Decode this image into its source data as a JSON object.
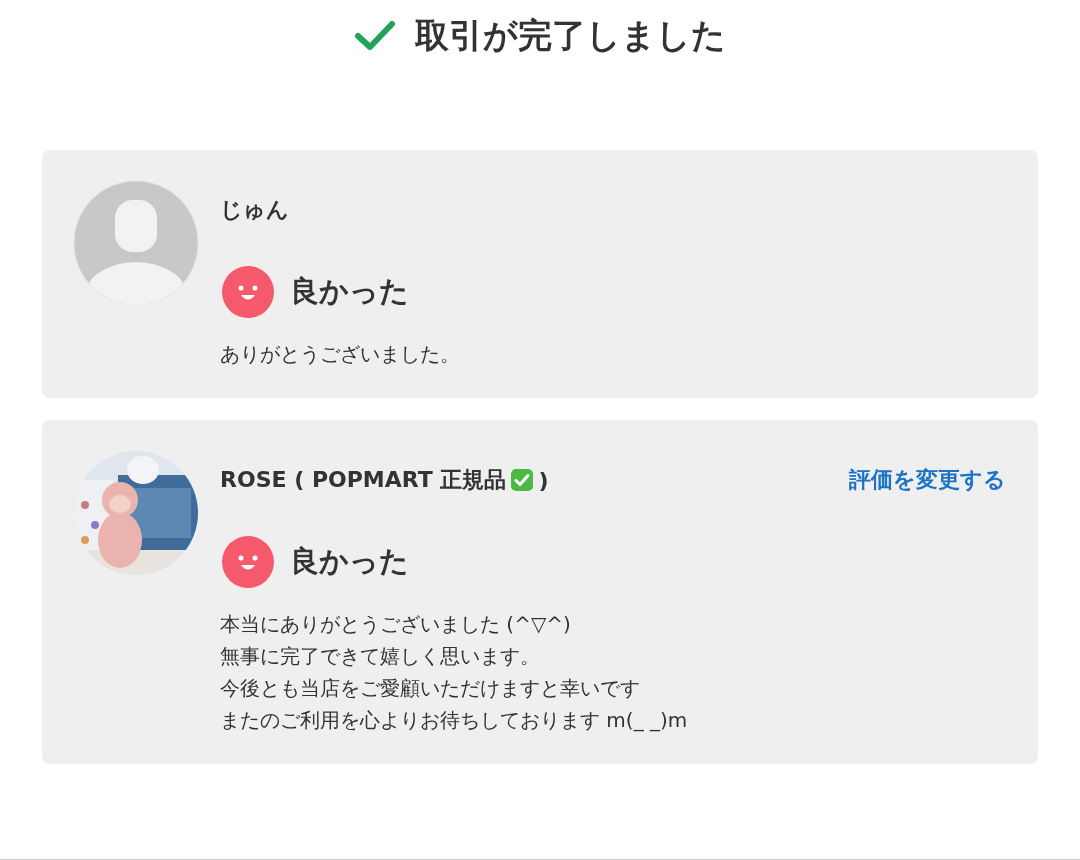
{
  "header": {
    "title": "取引が完了しました",
    "done": true
  },
  "reviews": [
    {
      "avatar": {
        "kind": "default"
      },
      "name": "じゅん",
      "verified": false,
      "rating": {
        "kind": "good",
        "label": "良かった"
      },
      "comment": [
        "ありがとうございました。"
      ]
    },
    {
      "name": "ROSE ( POPMART 正規品",
      "verified": true,
      "name_end": ")",
      "action": "評価を変更する",
      "rating": {
        "kind": "good",
        "label": "良かった"
      },
      "comment": [
        "本当にありがとうございました (^▽^)",
        "無事に完了できて嬉しく思います。",
        "今後とも当店をご愛顧いただけますと幸いです",
        "またのご利用を心よりお待ちしております m(_ _)m"
      ]
    }
  ]
}
